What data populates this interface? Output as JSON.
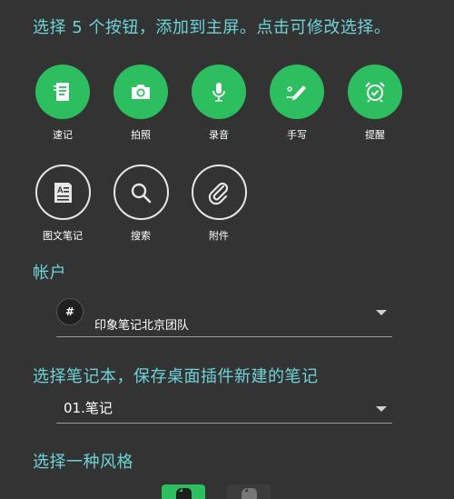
{
  "header": {
    "instruction": "选择 5 个按钮，添加到主屏。点击可修改选择。"
  },
  "buttons": {
    "row1": [
      {
        "label": "速记",
        "icon": "note-quick-icon"
      },
      {
        "label": "拍照",
        "icon": "camera-icon"
      },
      {
        "label": "录音",
        "icon": "microphone-icon"
      },
      {
        "label": "手写",
        "icon": "handwriting-icon"
      },
      {
        "label": "提醒",
        "icon": "alarm-clock-icon"
      }
    ],
    "row2": [
      {
        "label": "图文笔记",
        "icon": "text-note-icon"
      },
      {
        "label": "搜索",
        "icon": "search-icon"
      },
      {
        "label": "附件",
        "icon": "paperclip-icon"
      }
    ]
  },
  "account": {
    "heading": "帐户",
    "icon_symbol": "#",
    "selected": "印象笔记北京团队"
  },
  "notebook": {
    "heading": "选择笔记本，保存桌面插件新建的笔记",
    "selected": "01.笔记"
  },
  "style": {
    "heading": "选择一种风格",
    "options": [
      {
        "name": "green-style",
        "color": "#2dbe60"
      },
      {
        "name": "dark-style",
        "color": "#4a4a4a"
      }
    ]
  },
  "colors": {
    "background": "#333333",
    "accent": "#2dbe60",
    "heading": "#6ed3d6"
  }
}
